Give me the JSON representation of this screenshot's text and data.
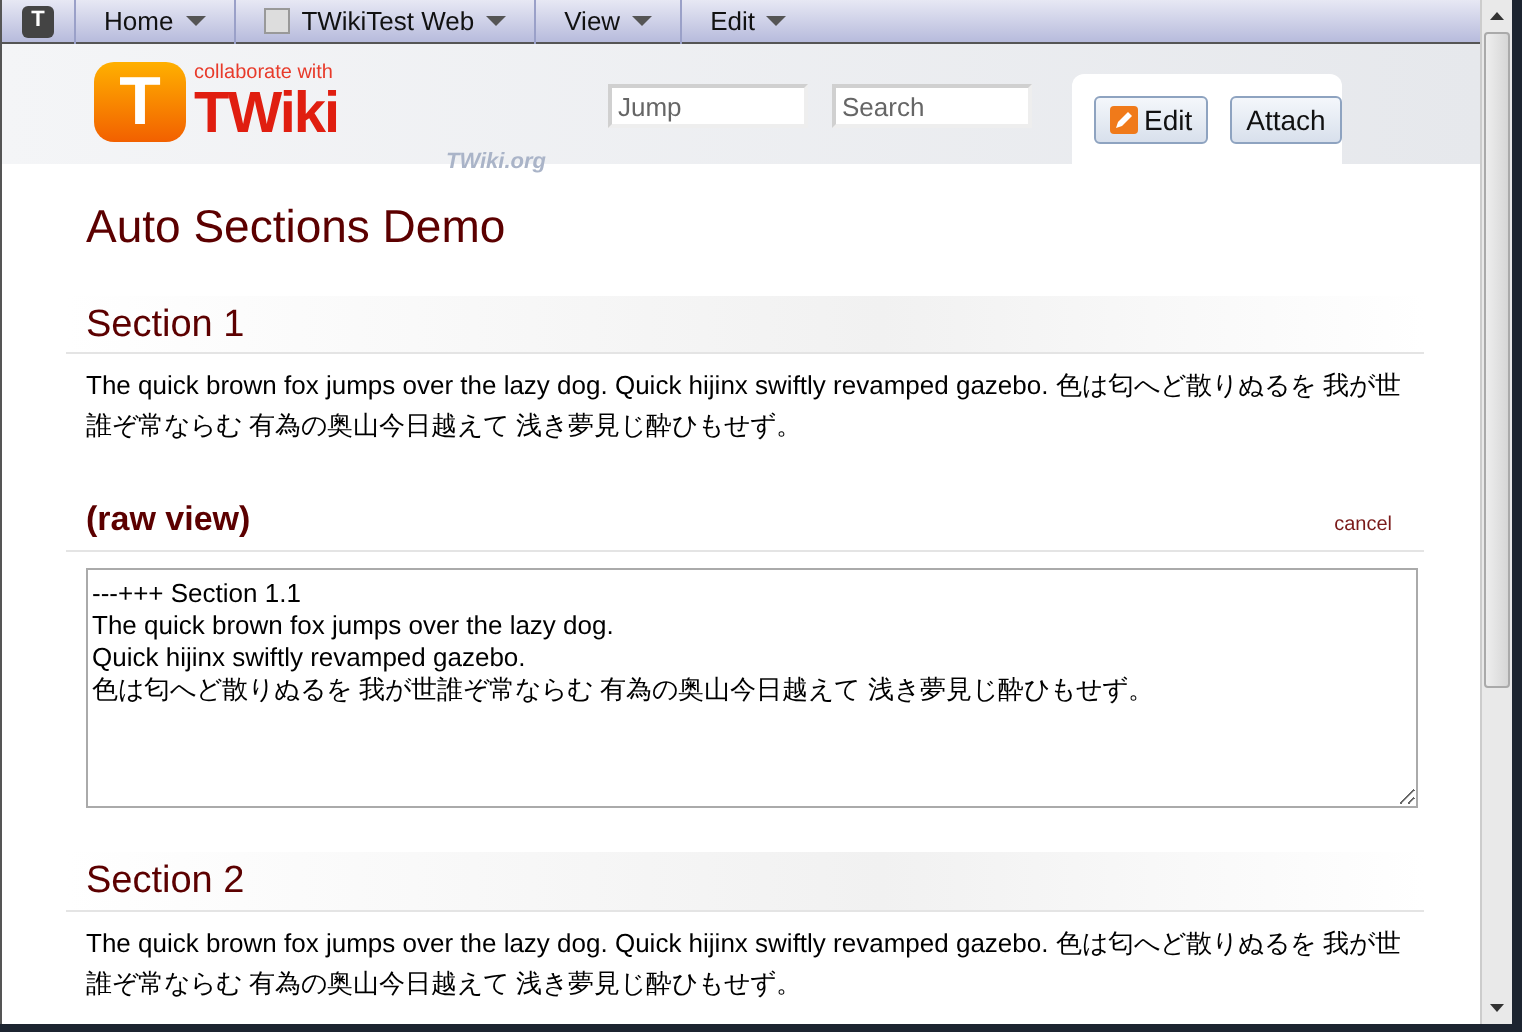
{
  "toolbar": {
    "logo_letter": "T",
    "items": [
      {
        "label": "Home",
        "kind": "menu"
      },
      {
        "label": "TWikiTest Web",
        "kind": "web"
      },
      {
        "label": "View",
        "kind": "menu"
      },
      {
        "label": "Edit",
        "kind": "menu"
      }
    ]
  },
  "logo": {
    "letter": "T",
    "tagline": "collaborate with",
    "wordmark": "TWiki",
    "site": "TWiki.org"
  },
  "jump": {
    "placeholder": "Jump"
  },
  "search": {
    "placeholder": "Search"
  },
  "buttons": [
    {
      "label": "Edit",
      "kind": "edit"
    },
    {
      "label": "Attach",
      "kind": "plain"
    }
  ],
  "page_title": "Auto Sections Demo",
  "sections": [
    {
      "kind": "section",
      "heading": "Section 1",
      "text": "The quick brown fox jumps over the lazy dog. Quick hijinx swiftly revamped gazebo. 色は匂へど散りぬるを 我が世誰ぞ常ならむ 有為の奥山今日越えて 浅き夢見じ酔ひもせず。"
    },
    {
      "kind": "raw",
      "heading": "(raw view)",
      "action": "cancel",
      "lines": [
        "---+++ Section 1.1",
        "The quick brown fox jumps over the lazy dog.",
        "Quick hijinx swiftly revamped gazebo.",
        "色は匂へど散りぬるを 我が世誰ぞ常ならむ 有為の奥山今日越えて 浅き夢見じ酔ひもせず。"
      ]
    },
    {
      "kind": "section",
      "heading": "Section 2",
      "text": "The quick brown fox jumps over the lazy dog. Quick hijinx swiftly revamped gazebo. 色は匂へど散りぬるを 我が世誰ぞ常ならむ 有為の奥山今日越えて 浅き夢見じ酔ひもせず。"
    }
  ]
}
